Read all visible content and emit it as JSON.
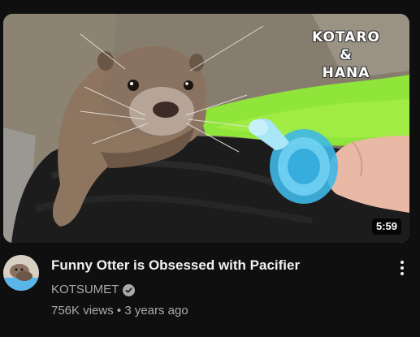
{
  "video": {
    "title": "Funny Otter is Obsessed with Pacifier",
    "channel": "KOTSUMET",
    "views": "756K views",
    "separator": "•",
    "age": "3 years ago",
    "duration": "5:59",
    "verified": true
  },
  "thumbnail": {
    "overlay_line1": "KOTARO",
    "overlay_line2": "&",
    "overlay_line3": "HANA"
  },
  "icons": {
    "verified": "verified-check-icon",
    "more": "more-vert-icon"
  },
  "colors": {
    "background": "#0f0f0f",
    "primary_text": "#f1f1f1",
    "secondary_text": "#aaaaaa"
  }
}
